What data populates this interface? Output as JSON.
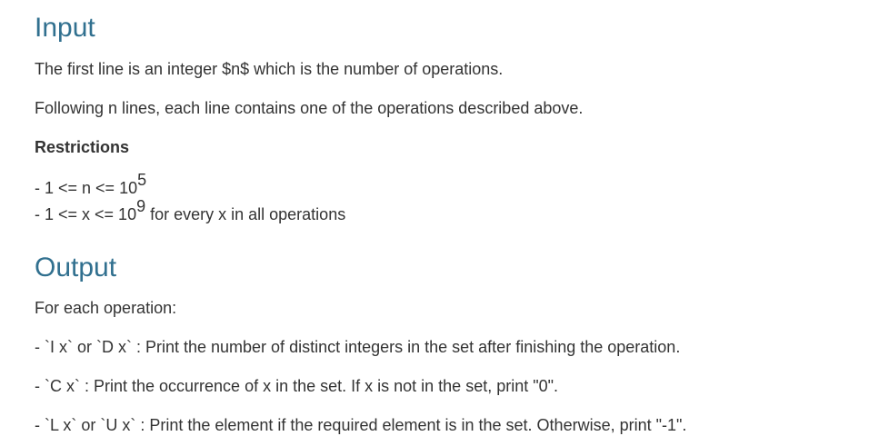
{
  "input": {
    "heading": "Input",
    "line1": "The first line is an integer $n$ which is the number of operations.",
    "line2": "Following n lines, each line contains one of the operations described above.",
    "restrictions_heading": "Restrictions",
    "restriction1": {
      "prefix": "- 1 <= n <= 10",
      "exponent": "5",
      "suffix": ""
    },
    "restriction2": {
      "prefix": "- 1 <= x <= 10",
      "exponent": "9",
      "suffix": " for every x in all operations"
    }
  },
  "output": {
    "heading": "Output",
    "intro": "For each operation:",
    "item1": "- `I x` or `D x` : Print the number of distinct integers in the set after finishing the operation.",
    "item2": "- `C x` : Print the occurrence of x in the set. If x is not in the set, print \"0\".",
    "item3": "- `L x` or `U x` : Print the element if the required element is in the set. Otherwise, print \"-1\"."
  }
}
